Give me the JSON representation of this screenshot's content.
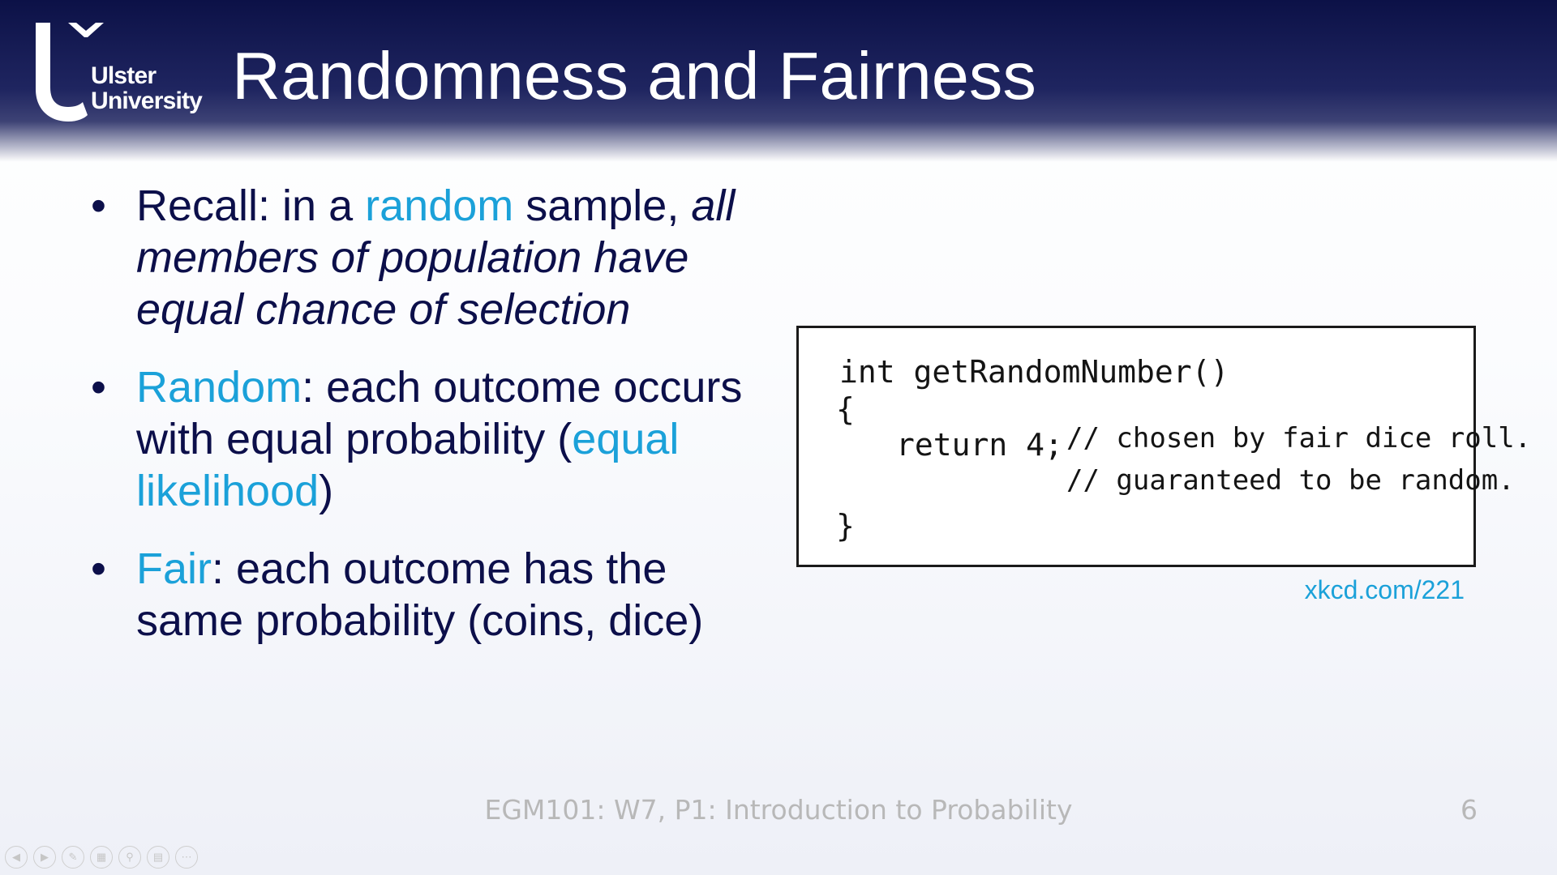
{
  "header": {
    "logo": {
      "line1": "Ulster",
      "line2": "University"
    },
    "title": "Randomness and Fairness"
  },
  "bullets": [
    {
      "parts": [
        {
          "text": "Recall: in a ",
          "style": "normal"
        },
        {
          "text": "random",
          "style": "accent"
        },
        {
          "text": " sample, ",
          "style": "normal"
        },
        {
          "text": "all members of population have equal chance of selection",
          "style": "italic"
        }
      ]
    },
    {
      "parts": [
        {
          "text": "Random",
          "style": "accent"
        },
        {
          "text": ": each outcome occurs with equal probability (",
          "style": "normal"
        },
        {
          "text": "equal likelihood",
          "style": "accent"
        },
        {
          "text": ")",
          "style": "normal"
        }
      ]
    },
    {
      "parts": [
        {
          "text": "Fair",
          "style": "accent"
        },
        {
          "text": ": each outcome has the same probability (coins, dice)",
          "style": "normal"
        }
      ]
    }
  ],
  "comic": {
    "lines": [
      "int getRandomNumber()",
      "{",
      "return 4;",
      "// chosen by fair dice roll.",
      "// guaranteed to be random.",
      "}"
    ]
  },
  "credit": "xkcd.com/221",
  "footer": {
    "text": "EGM101: W7, P1: Introduction to Probability",
    "page": "6"
  },
  "controls": {
    "icons": [
      "prev-icon",
      "next-icon",
      "pen-icon",
      "slides-icon",
      "zoom-icon",
      "subtitles-icon",
      "more-icon"
    ]
  },
  "colors": {
    "header": "#1f2560",
    "text": "#0c0f4a",
    "accent": "#1ba1d9",
    "footer": "#b8b8b8"
  }
}
